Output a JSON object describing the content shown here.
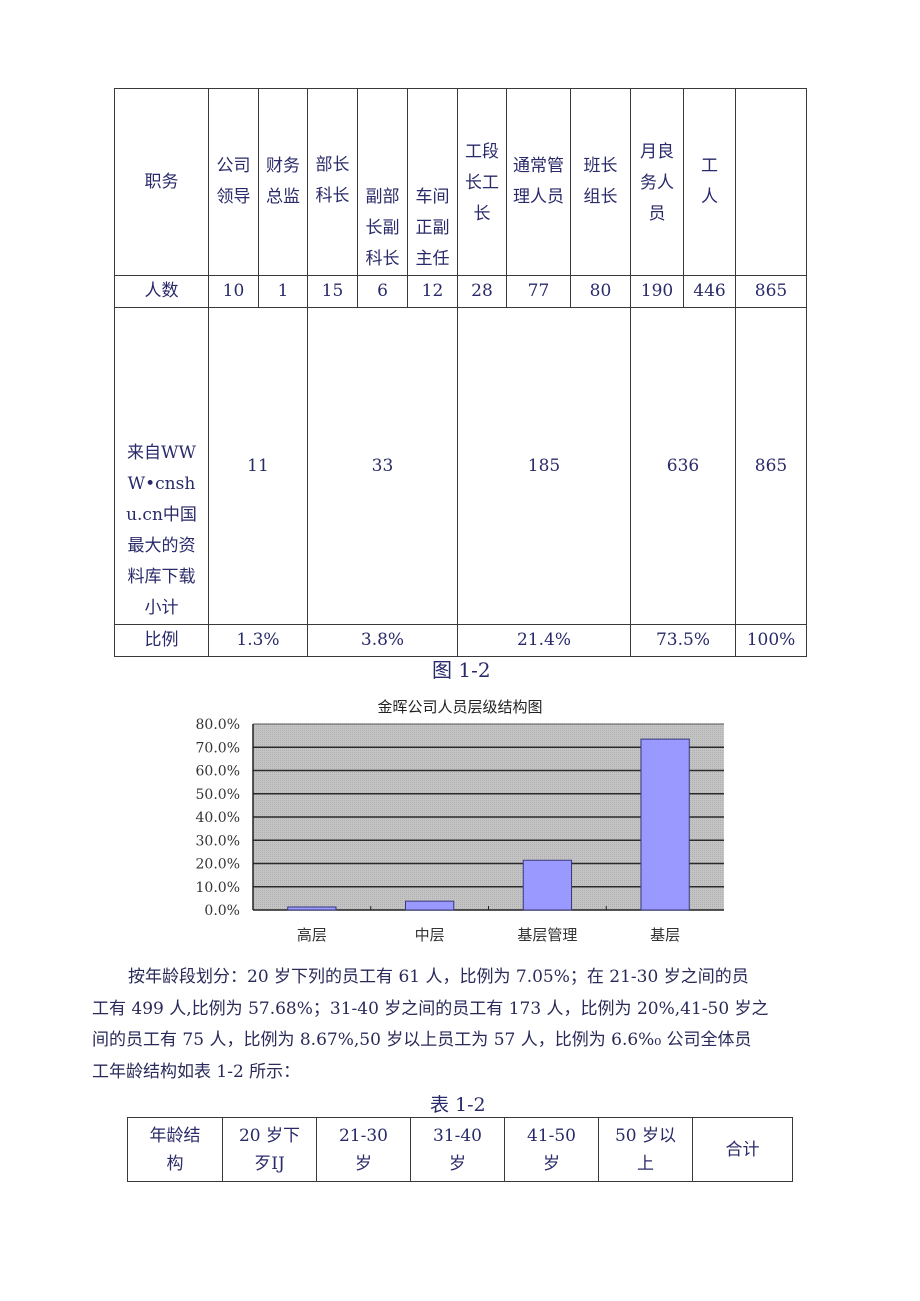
{
  "table1": {
    "header_row": {
      "label": "职务",
      "cells": [
        "公司领导",
        "财务总监",
        "部长科长",
        "副部长副科长",
        "车间正副主任",
        "工段长工长",
        "通常管理人员",
        "班长组长",
        "月良务人员",
        "工人",
        ""
      ]
    },
    "count_row": {
      "label": "人数",
      "cells": [
        "10",
        "1",
        "15",
        "6",
        "12",
        "28",
        "77",
        "80",
        "190",
        "446",
        "865"
      ]
    },
    "subtotal_row": {
      "label": "来自WWW•cnshu.cn中国最大的资料库下载小计",
      "cells": [
        "11",
        "33",
        "185",
        "636",
        "865"
      ]
    },
    "ratio_row": {
      "label": "比例",
      "cells": [
        "1.3%",
        "3.8%",
        "21.4%",
        "73.5%",
        "100%"
      ]
    }
  },
  "figure_caption": "图 1-2",
  "chart_data": {
    "type": "bar",
    "title": "金晖公司人员层级结构图",
    "categories": [
      "高层",
      "中层",
      "基层管理",
      "基层"
    ],
    "values": [
      1.3,
      3.8,
      21.4,
      73.5
    ],
    "xlabel": "",
    "ylabel": "",
    "ylim": [
      0,
      80
    ],
    "yticks": [
      "0.0%",
      "10.0%",
      "20.0%",
      "30.0%",
      "40.0%",
      "50.0%",
      "60.0%",
      "70.0%",
      "80.0%"
    ],
    "grid": true,
    "legend": "none",
    "bar_color": "#9999ff",
    "plot_bg": "#c0c0c0"
  },
  "paragraph": {
    "lines": [
      "按年龄段划分：20 岁下列的员工有 61 人，比例为 7.05%；在 21-30 岁之间的员",
      "工有 499 人,比例为 57.68%；31-40 岁之间的员工有 173 人，比例为 20%,41-50 岁之",
      "间的员工有 75 人，比例为 8.67%,50 岁以上员工为 57 人，比例为 6.6%₀ 公司全体员",
      "工年龄结构如表 1-2 所示："
    ]
  },
  "table2": {
    "caption": "表 1-2",
    "headers": [
      "年龄结构",
      "20 岁下歹IJ",
      "21-30 岁",
      "31-40 岁",
      "41-50 岁",
      "50 岁以上",
      "合计"
    ]
  }
}
